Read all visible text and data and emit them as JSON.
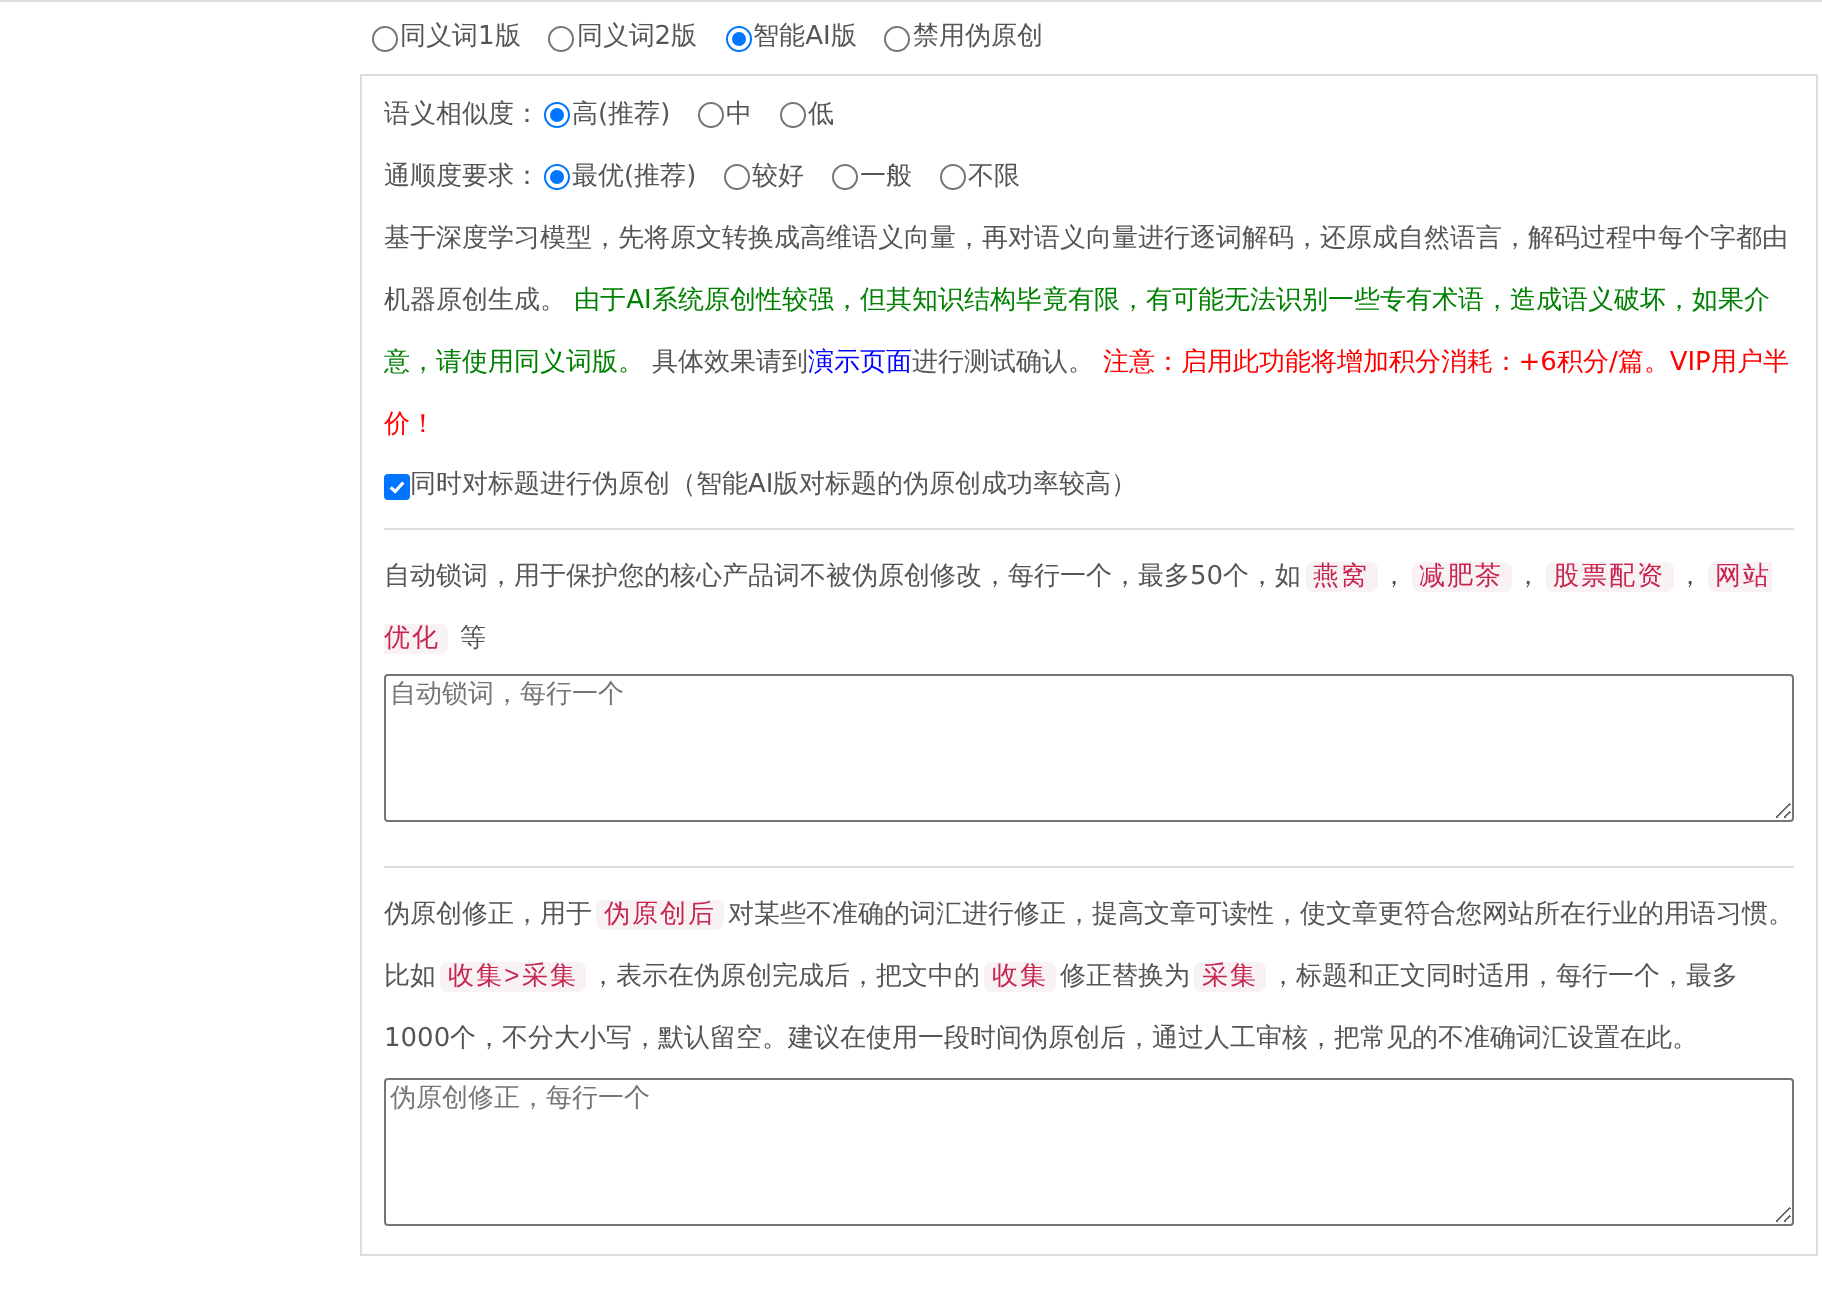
{
  "modes": [
    {
      "label": "同义词1版",
      "selected": false
    },
    {
      "label": "同义词2版",
      "selected": false
    },
    {
      "label": "智能AI版",
      "selected": true
    },
    {
      "label": "禁用伪原创",
      "selected": false
    }
  ],
  "similarity": {
    "label": "语义相似度：",
    "options": [
      {
        "label": "高(推荐)",
        "selected": true
      },
      {
        "label": "中",
        "selected": false
      },
      {
        "label": "低",
        "selected": false
      }
    ]
  },
  "fluency": {
    "label": "通顺度要求：",
    "options": [
      {
        "label": "最优(推荐)",
        "selected": true
      },
      {
        "label": "较好",
        "selected": false
      },
      {
        "label": "一般",
        "selected": false
      },
      {
        "label": "不限",
        "selected": false
      }
    ]
  },
  "description": [
    {
      "kind": "plain",
      "text": "基于深度学习模型，先将原文转换成高维语义向量，再对语义向量进行逐词解码，还原成自然语言，解码过程中每个字都由机器原创生成。 "
    },
    {
      "kind": "green",
      "text": "由于AI系统原创性较强，但其知识结构毕竟有限，有可能无法识别一些专有术语，造成语义破坏，如果介意，请使用同义词版。"
    },
    {
      "kind": "plain",
      "text": " 具体效果请到"
    },
    {
      "kind": "link",
      "text": "演示页面"
    },
    {
      "kind": "plain",
      "text": "进行测试确认。 "
    },
    {
      "kind": "red",
      "text": "注意：启用此功能将增加积分消耗：+6积分/篇。VIP用户半价！"
    }
  ],
  "title_option": {
    "label": "同时对标题进行伪原创（智能AI版对标题的伪原创成功率较高）",
    "checked": true
  },
  "lock_words": {
    "description": [
      {
        "kind": "plain",
        "text": "自动锁词，用于保护您的核心产品词不被伪原创修改，每行一个，最多50个，如"
      },
      {
        "kind": "tag",
        "text": "燕窝"
      },
      {
        "kind": "plain",
        "text": "，"
      },
      {
        "kind": "tag",
        "text": "减肥茶"
      },
      {
        "kind": "plain",
        "text": "，"
      },
      {
        "kind": "tag",
        "text": "股票配资"
      },
      {
        "kind": "plain",
        "text": "，"
      },
      {
        "kind": "tag",
        "text": "网站优化"
      },
      {
        "kind": "plain",
        "text": " 等"
      }
    ],
    "placeholder": "自动锁词，每行一个"
  },
  "correction": {
    "description": [
      {
        "kind": "plain",
        "text": "伪原创修正，用于"
      },
      {
        "kind": "tag",
        "text": "伪原创后"
      },
      {
        "kind": "plain",
        "text": "对某些不准确的词汇进行修正，提高文章可读性，使文章更符合您网站所在行业的用语习惯。比如"
      },
      {
        "kind": "tag",
        "text": "收集>采集"
      },
      {
        "kind": "plain",
        "text": "，表示在伪原创完成后，把文中的"
      },
      {
        "kind": "tag",
        "text": "收集"
      },
      {
        "kind": "plain",
        "text": "修正替换为"
      },
      {
        "kind": "tag",
        "text": "采集"
      },
      {
        "kind": "plain",
        "text": "，标题和正文同时适用，每行一个，最多1000个，不分大小写，默认留空。建议在使用一段时间伪原创后，通过人工审核，把常见的不准确词汇设置在此。"
      }
    ],
    "placeholder": "伪原创修正，每行一个"
  }
}
